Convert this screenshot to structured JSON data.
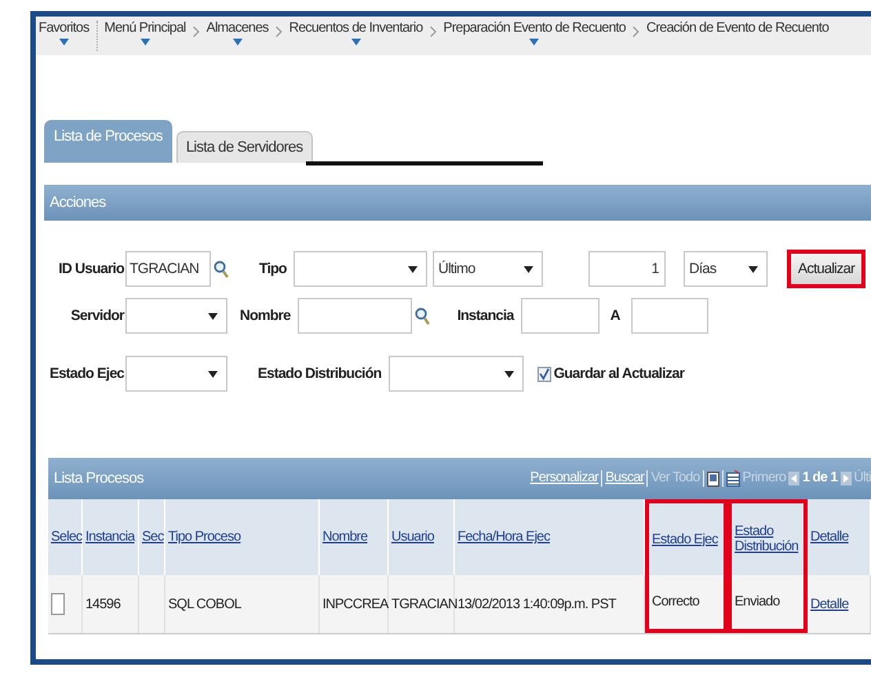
{
  "breadcrumb": [
    {
      "label": "Favoritos",
      "menu": true
    },
    {
      "label": "Menú Principal",
      "menu": true
    },
    {
      "label": "Almacenes",
      "menu": true
    },
    {
      "label": "Recuentos de Inventario",
      "menu": true
    },
    {
      "label": "Preparación Evento de Recuento",
      "menu": true
    },
    {
      "label": "Creación de Evento de Recuento",
      "menu": false
    }
  ],
  "tabs": [
    {
      "label": "Lista de Procesos",
      "selected": true
    },
    {
      "label": "Lista de Servidores",
      "selected": false
    }
  ],
  "acciones": {
    "title": "Acciones",
    "rows": [
      {
        "items": [
          {
            "kind": "label",
            "text": "ID Usuario"
          },
          {
            "kind": "input",
            "value": "TGRACIAN"
          },
          {
            "kind": "search"
          },
          {
            "kind": "label",
            "text": "Tipo"
          },
          {
            "kind": "select"
          },
          {
            "kind": "select",
            "value": "Último"
          },
          {
            "kind": "number",
            "value": "1"
          },
          {
            "kind": "select",
            "value": "Días"
          },
          {
            "kind": "button",
            "label": "Actualizar",
            "highlighted": true
          }
        ]
      },
      {
        "items": [
          {
            "kind": "label",
            "text": "Servidor"
          },
          {
            "kind": "select"
          },
          {
            "kind": "label",
            "text": "Nombre"
          },
          {
            "kind": "input"
          },
          {
            "kind": "search"
          },
          {
            "kind": "label",
            "text": "Instancia"
          },
          {
            "kind": "input"
          },
          {
            "kind": "label",
            "text": "A"
          },
          {
            "kind": "input"
          }
        ]
      },
      {
        "items": [
          {
            "kind": "label",
            "text": "Estado Ejec"
          },
          {
            "kind": "select"
          },
          {
            "kind": "label",
            "text": "Estado Distribución"
          },
          {
            "kind": "select"
          },
          {
            "kind": "checkbox",
            "label": "Guardar al Actualizar",
            "checked": true
          }
        ]
      }
    ]
  },
  "lista": {
    "title": "Lista Procesos",
    "nav": [
      {
        "kind": "link",
        "text": "Personalizar"
      },
      {
        "kind": "bar"
      },
      {
        "kind": "link",
        "text": "Buscar"
      },
      {
        "kind": "bar"
      },
      {
        "kind": "muted",
        "text": "Ver Todo"
      },
      {
        "kind": "bar"
      },
      {
        "kind": "zoom-icon"
      },
      {
        "kind": "bar"
      },
      {
        "kind": "download-icon"
      },
      {
        "kind": "muted",
        "text": "Primero"
      },
      {
        "kind": "prev-icon"
      },
      {
        "kind": "bold",
        "text": "1 de 1"
      },
      {
        "kind": "next-icon"
      },
      {
        "kind": "muted",
        "text": "Últi"
      }
    ],
    "columns": [
      {
        "label": "Selec",
        "highlighted": false
      },
      {
        "label": "Instancia",
        "highlighted": false
      },
      {
        "label": "Sec",
        "highlighted": false
      },
      {
        "label": "Tipo Proceso",
        "highlighted": false
      },
      {
        "label": "Nombre",
        "highlighted": false
      },
      {
        "label": "Usuario",
        "highlighted": false
      },
      {
        "label": "Fecha/Hora Ejec",
        "highlighted": false
      },
      {
        "label": "Estado Ejec",
        "highlighted": true
      },
      {
        "label": "Estado Distribución",
        "highlighted": true
      },
      {
        "label": "Detalle",
        "highlighted": false
      }
    ],
    "rows": [
      {
        "cells": [
          {
            "kind": "checkbox",
            "checked": false
          },
          {
            "kind": "text",
            "text": "14596"
          },
          {
            "kind": "empty"
          },
          {
            "kind": "text",
            "text": "SQL COBOL"
          },
          {
            "kind": "text",
            "text": "INPCCREA"
          },
          {
            "kind": "text",
            "text": "TGRACIAN"
          },
          {
            "kind": "text",
            "text": "13/02/2013  1:40:09p.m. PST"
          },
          {
            "kind": "text",
            "text": "Correcto"
          },
          {
            "kind": "text",
            "text": "Enviado"
          },
          {
            "kind": "link",
            "text": "Detalle"
          }
        ]
      }
    ]
  }
}
